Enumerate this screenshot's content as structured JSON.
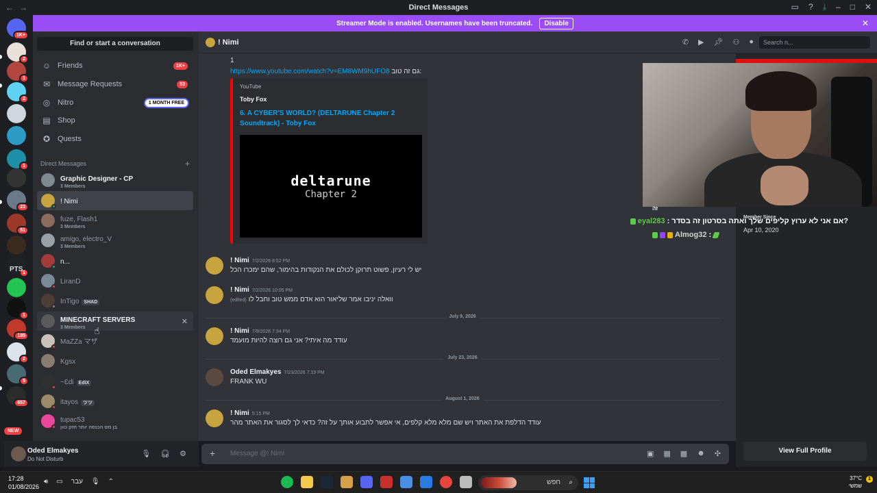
{
  "titlebar": {
    "title": "Direct Messages"
  },
  "banner": {
    "text": "Streamer Mode is enabled. Usernames have been truncated.",
    "button": "Disable"
  },
  "rail": {
    "servers": [
      {
        "badge": "1K+",
        "color": "#5865f2"
      },
      {
        "badge": "2",
        "color": "#e7e1da"
      },
      {
        "badge": "1",
        "color": "#b3473f"
      },
      {
        "badge": "2",
        "color": "#5fd2f3"
      },
      {
        "badge": "",
        "color": "#cfd6de"
      },
      {
        "badge": "",
        "color": "#2e9bc6"
      },
      {
        "badge": "1",
        "color": "#1f8fa8"
      },
      {
        "badge": "",
        "color": "#333"
      },
      {
        "badge": "23",
        "color": "#6a7a8a"
      },
      {
        "badge": "51",
        "color": "#9c3a2a"
      },
      {
        "badge": "",
        "color": "#3b2a1e"
      },
      {
        "badge": "1",
        "color": "#202225"
      },
      {
        "badge": "",
        "color": "#23c552"
      },
      {
        "badge": "1",
        "color": "#111"
      },
      {
        "badge": "185",
        "color": "#c0392b"
      },
      {
        "badge": "2",
        "color": "#dde3ea"
      },
      {
        "badge": "5",
        "color": "#486a73"
      },
      {
        "badge": "657",
        "color": "#2c2c2c"
      }
    ],
    "pts_label": "PTS",
    "new_label": "NEW"
  },
  "sidebar": {
    "find": "Find or start a conversation",
    "nav": [
      {
        "label": "Friends",
        "count": "1K+"
      },
      {
        "label": "Message Requests",
        "count": "53"
      },
      {
        "label": "Nitro",
        "promo": "1 MONTH FREE"
      },
      {
        "label": "Shop"
      },
      {
        "label": "Quests"
      }
    ],
    "dm_header": "Direct Messages",
    "dms": [
      {
        "name": "Graphic Designer - CP",
        "sub": "3 Members"
      },
      {
        "name": "! Nimi"
      },
      {
        "name": "fuze, Flash1",
        "sub": "3 Members"
      },
      {
        "name": "amigo, electro_V",
        "sub": "3 Members"
      },
      {
        "name": "n..."
      },
      {
        "name": "LiranD"
      },
      {
        "name": "InTigo",
        "tag": "SHAD"
      },
      {
        "name": "MINECRAFT SERVERS",
        "sub": "3 Members"
      },
      {
        "name": "MaZZa マザ"
      },
      {
        "name": "Kgsx"
      },
      {
        "name": "~Ɛdi",
        "tag": "EdiX"
      },
      {
        "name": "itayos",
        "tag": "ツツ"
      },
      {
        "name": "tupac53",
        "sub": "בן מס הכנסה יותר חזק כוון"
      }
    ]
  },
  "user": {
    "name": "Oded Elmakyes",
    "status": "Do Not Disturb"
  },
  "chat": {
    "channel": "! Nimi",
    "search_placeholder": "Search n...",
    "top_line": "1",
    "link_text": "גם זה טוב:",
    "link_url": "https://www.youtube.com/watch?v=EM8WM9hUFO8",
    "embed": {
      "provider": "YouTube",
      "author": "Toby Fox",
      "title": "6. A CYBER'S WORLD? (DELTARUNE Chapter 2 Soundtrack) - Toby Fox",
      "logo": "deltarune",
      "chapter": "Chapter 2"
    },
    "messages": [
      {
        "author": "! Nimi",
        "time": "7/2/2026 8:52 PM",
        "text": "יש לי רעיון, פשוט תרוקן לכולם את הנקודות בהימור, שהם ימכרו הכל"
      },
      {
        "author": "! Nimi",
        "time": "7/2/2026 10:05 PM",
        "text": "וואלה יניבו אמר שליאור הוא אדם ממש טוב וחבל לו",
        "edited": "(edited)"
      },
      {
        "author": "! Nimi",
        "time": "7/9/2026 7:34 PM",
        "text": "עודד מה איתי? אני גם רוצה להיות מועמד"
      },
      {
        "author": "Oded Elmakyes",
        "time": "7/23/2026 7:19 PM",
        "text": "FRANK WU"
      },
      {
        "author": "! Nimi",
        "time": "5:15 PM",
        "text": "עודד הדלפת את האתר ויש שם מלא מלא קלפים, אי אפשר לתבוע אותך על זה? כדאי לך לסגור את האתר מהר"
      }
    ],
    "dividers": [
      "July 9, 2026",
      "July 23, 2026",
      "August 1, 2026"
    ],
    "composer_placeholder": "Message @! Nimi"
  },
  "profile": {
    "member_since_label": "Member Since",
    "member_since": "Apr 10, 2020",
    "full_button": "View Full Profile"
  },
  "overlay_chat": {
    "line0": "זה",
    "line1_user": "eyal283",
    "line1_text": ": אם אני לא ערוץ קליפים שלך ואתה בסרטון זה בסדר?",
    "line2_user": "Almog32",
    "line2_text": ":"
  },
  "taskbar": {
    "time": "17:28",
    "date": "01/08/2026",
    "lang": "עבר",
    "search": "חפש",
    "temp": "37°C",
    "weather": "שמשי",
    "notif": "1"
  }
}
